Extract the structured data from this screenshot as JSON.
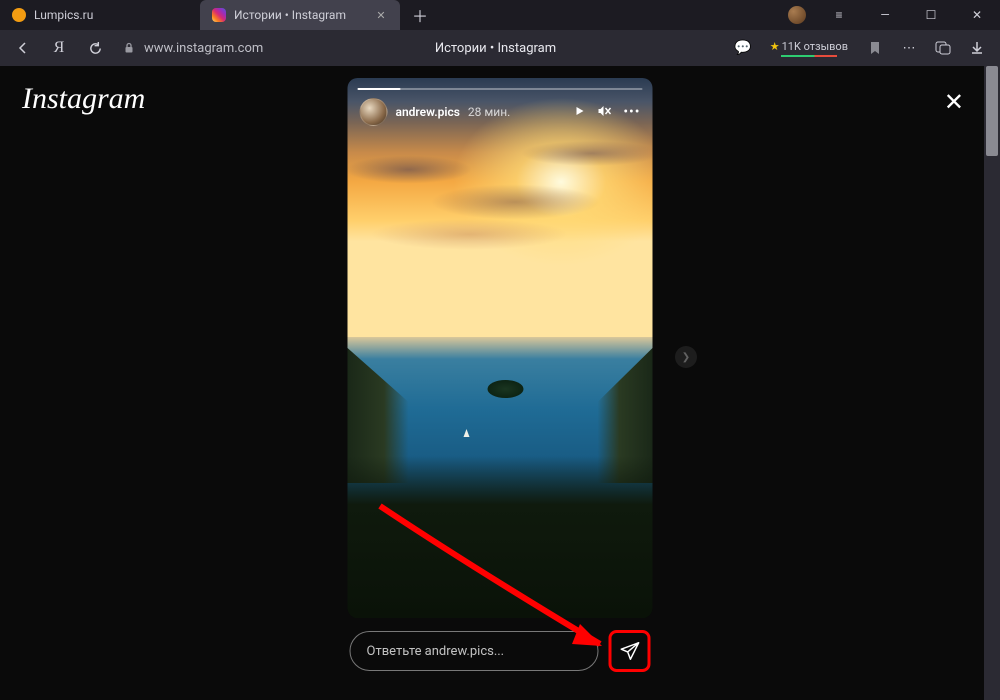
{
  "tabs": [
    {
      "title": "Lumpics.ru",
      "favicon_bg": "#f39c12"
    },
    {
      "title": "Истории • Instagram",
      "favicon_bg": "linear-gradient(45deg,#feda75,#fa7e1e,#d62976,#962fbf,#4f5bd5)"
    }
  ],
  "url": {
    "host": "www.instagram.com"
  },
  "page_title": "Истории • Instagram",
  "reviews": {
    "star": "★",
    "text": "11K отзывов"
  },
  "logo": "Instagram",
  "story": {
    "username": "andrew.pics",
    "time": "28 мин.",
    "reply_placeholder": "Ответьте andrew.pics..."
  }
}
